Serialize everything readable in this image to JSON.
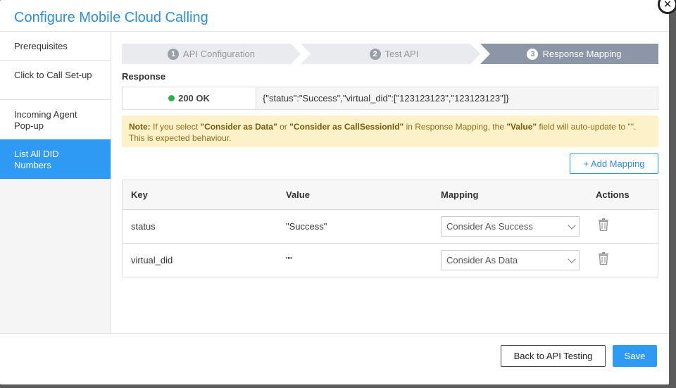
{
  "modal": {
    "title": "Configure Mobile Cloud Calling",
    "close_glyph": "✕"
  },
  "sidebar": {
    "items": [
      {
        "label": "Prerequisites"
      },
      {
        "label": "Click to Call Set-up"
      },
      {
        "label": "Incoming Agent Pop-up"
      },
      {
        "label": "List All DID Numbers"
      }
    ]
  },
  "steps": [
    {
      "num": "1",
      "label": "API Configuration"
    },
    {
      "num": "2",
      "label": "Test API"
    },
    {
      "num": "3",
      "label": "Response Mapping"
    }
  ],
  "response": {
    "label": "Response",
    "status": "200 OK",
    "status_color": "#2bb24c",
    "body": "{\"status\":\"Success\",\"virtual_did\":[\"123123123\",\"123123123\"]}"
  },
  "note": {
    "prefix": "Note:",
    "t1": " If you select ",
    "b1": "\"Consider as Data\"",
    "t2": " or ",
    "b2": "\"Consider as CallSessionId\"",
    "t3": " in Response Mapping, the ",
    "b3": "\"Value\"",
    "t4": " field will auto-update to \"\". This is expected behaviour."
  },
  "add_mapping_label": "+ Add Mapping",
  "table": {
    "headers": {
      "key": "Key",
      "value": "Value",
      "mapping": "Mapping",
      "actions": "Actions"
    },
    "rows": [
      {
        "key": "status",
        "value": "\"Success\"",
        "mapping": "Consider As Success"
      },
      {
        "key": "virtual_did",
        "value": "\"\"",
        "mapping": "Consider As Data"
      }
    ]
  },
  "footer": {
    "back_label": "Back to API Testing",
    "save_label": "Save"
  },
  "colors": {
    "accent": "#2f9af3",
    "title": "#2d8fd5",
    "note_bg": "#fcf1c7"
  }
}
